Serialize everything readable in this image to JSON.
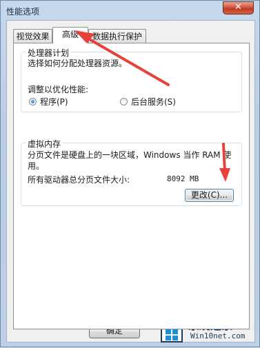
{
  "window": {
    "title": "性能选项",
    "close_label": "✕"
  },
  "tabs": [
    {
      "label": "视觉效果"
    },
    {
      "label": "高级"
    },
    {
      "label": "数据执行保护"
    }
  ],
  "processor_group": {
    "title": "处理器计划",
    "description": "选择如何分配处理器资源。",
    "adjust_label": "调整以优化性能:",
    "option_programs": "程序(P)",
    "option_background": "后台服务(S)",
    "selected": "option_programs"
  },
  "virtual_memory_group": {
    "title": "虚拟内存",
    "description_line1": "分页文件是硬盘上的一块区域，Windows 当作 RAM 使",
    "description_line2": "用。",
    "total_label": "所有驱动器总分页文件大小:",
    "total_value": "8092 MB",
    "change_button": "更改(C)..."
  },
  "footer": {
    "ok_button": "确定"
  },
  "annotations": {
    "arrow_color": "#e8413a"
  },
  "watermark": {
    "text": "系统之家",
    "url": "Win10net.com"
  }
}
